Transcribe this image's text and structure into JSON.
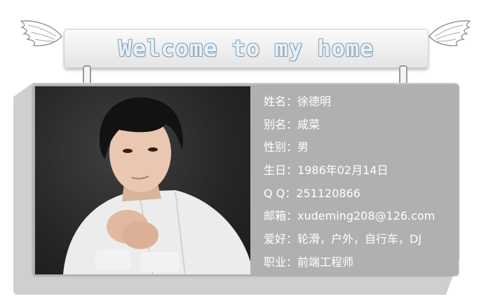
{
  "banner": {
    "title": "Welcome to my home"
  },
  "profile": {
    "rows": [
      {
        "label": "姓名",
        "value": "徐德明"
      },
      {
        "label": "别名",
        "value": "咸菜"
      },
      {
        "label": "性别",
        "value": "男"
      },
      {
        "label": "生日",
        "value": "1986年02月14日"
      },
      {
        "label": "Q Q",
        "value": "251120866"
      },
      {
        "label": "邮箱",
        "value": "xudeming208@126.com"
      },
      {
        "label": "爱好",
        "value": "轮滑，户外，自行车，DJ"
      },
      {
        "label": "职业",
        "value": "前端工程师"
      }
    ],
    "separator": "："
  },
  "colors": {
    "card_background": "#b0b0b0",
    "frame_shadow": "#cfcfcf",
    "text": "#ffffff",
    "title_fill": "#e7f1f8",
    "title_outline": "#8aa4b8"
  },
  "icons": [
    "angel-wing-left-icon",
    "angel-wing-right-icon",
    "hanging-clip-icon"
  ]
}
